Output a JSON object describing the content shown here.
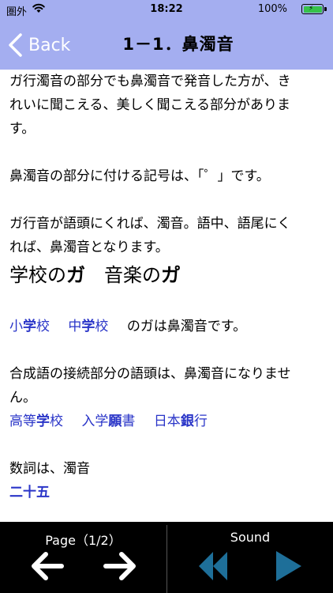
{
  "status": {
    "carrier": "圏外",
    "time": "18:22",
    "battery": "100%"
  },
  "nav": {
    "back_label": "Back",
    "title": "1－1．鼻濁音"
  },
  "content": {
    "para1_line1": "ガ行濁音の部分でも鼻濁音で発音した方が、き",
    "para1_line2": "れいに聞こえる、美しく聞こえる部分がありま",
    "para1_line3": "す。",
    "para2": "鼻濁音の部分に付ける記号は、「゜」です。",
    "para3_line1": "ガ行音が語頭にくれば、濁音。語中、語尾にく",
    "para3_line2": "れば、鼻濁音となります。",
    "example": {
      "w1_pre": "学校の",
      "w1_bold": "ガ",
      "w2_pre": "音楽の",
      "w2_bold": "カ゚"
    },
    "words1": [
      {
        "pre": "小",
        "bold": "学",
        "post": "校"
      },
      {
        "pre": "中",
        "bold": "学",
        "post": "校"
      }
    ],
    "words1_suffix": "のガは鼻濁音です。",
    "para4_line1": "合成語の接続部分の語頭は、鼻濁音になりませ",
    "para4_line2": "ん。",
    "words2": [
      {
        "pre": "高等",
        "bold": "学",
        "post": "校"
      },
      {
        "pre": "入学",
        "bold": "願",
        "post": "書"
      },
      {
        "pre": "日本",
        "bold": "銀",
        "post": "行"
      }
    ],
    "para5": "数詞は、濁音",
    "words3": [
      {
        "pre": "",
        "bold": "二十五",
        "post": ""
      }
    ]
  },
  "toolbar": {
    "page_label": "Page（1/2）",
    "sound_label": "Sound",
    "arrow_color": "#ffffff",
    "sound_color": "#1e6f99"
  }
}
